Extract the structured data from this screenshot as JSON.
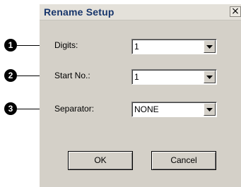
{
  "dialog": {
    "title": "Rename Setup",
    "close_glyph": "×"
  },
  "callouts": [
    "1",
    "2",
    "3"
  ],
  "fields": [
    {
      "label": "Digits:",
      "value": "1"
    },
    {
      "label": "Start No.:",
      "value": "1"
    },
    {
      "label": "Separator:",
      "value": "NONE"
    }
  ],
  "buttons": {
    "ok_label": "OK",
    "cancel_label": "Cancel"
  },
  "icons": {
    "close": "close-icon",
    "dropdown": "chevron-down-icon",
    "callout": "numbered-circle-icon"
  }
}
